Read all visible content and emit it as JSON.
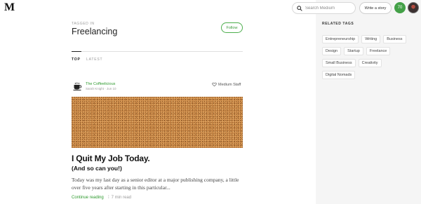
{
  "header": {
    "logo_text": "M",
    "search_placeholder": "Search Medium",
    "write_label": "Write a story",
    "notifications_count": "70"
  },
  "tag_page": {
    "tagged_in_label": "TAGGED IN",
    "tag_name": "Freelancing",
    "follow_label": "Follow",
    "tabs": [
      {
        "label": "TOP",
        "active": true
      },
      {
        "label": "LATEST",
        "active": false
      }
    ]
  },
  "post": {
    "publication": "The Coffeelicious",
    "author": "Sarah Knight",
    "date": "Jun 10",
    "staff_label": "Medium Staff",
    "title": "I Quit My Job Today.",
    "subtitle": "(And so can you!)",
    "excerpt": "Today was my last day as a senior editor at a major publishing company, a little over five years after starting in this particular...",
    "continue_label": "Continue reading",
    "read_time": "7 min read"
  },
  "sidebar": {
    "related_tags_title": "RELATED TAGS",
    "tags": [
      "Entrepreneurship",
      "Writing",
      "Business",
      "Design",
      "Startup",
      "Freelance",
      "Small Business",
      "Creativity",
      "Digital Nomads"
    ]
  },
  "colors": {
    "accent_green": "#2e9a2e",
    "sidebar_bg": "#f5f5f5",
    "avatar_badge": "#43a047"
  }
}
